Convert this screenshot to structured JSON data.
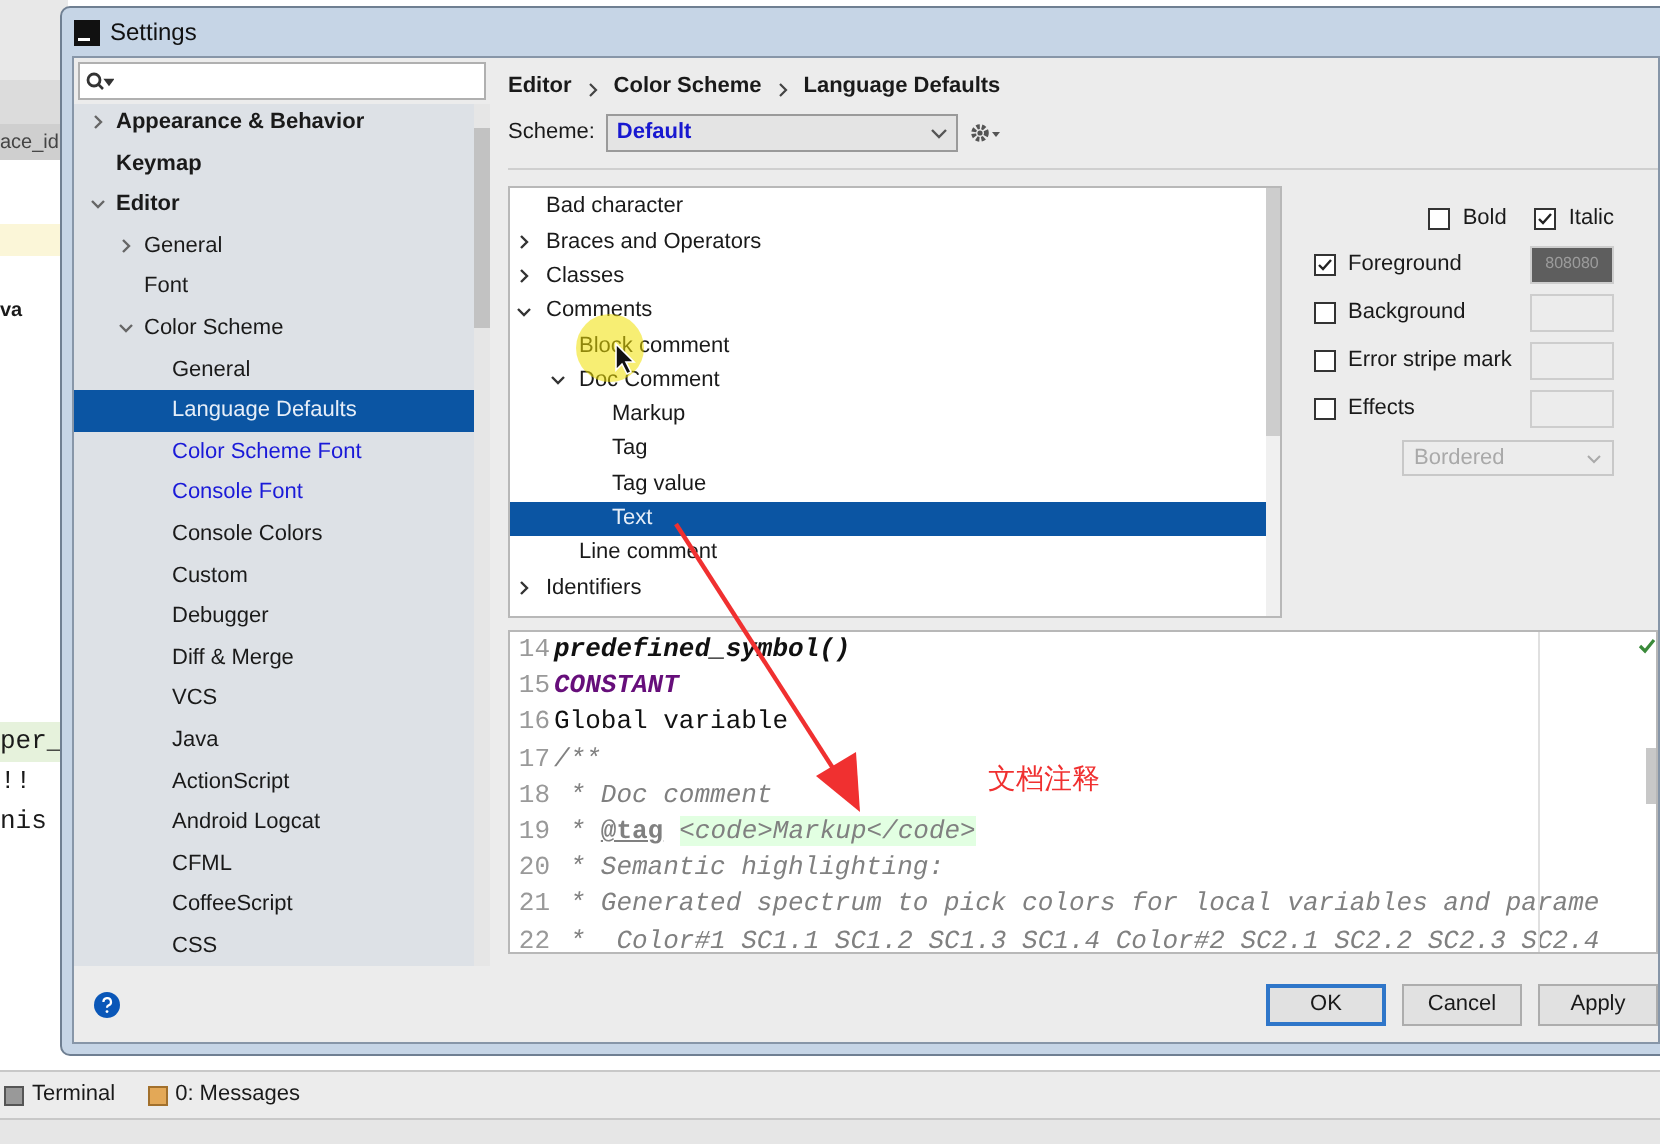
{
  "ide": {
    "tab": "ace_id",
    "fragments": [
      {
        "text": "va",
        "kind": "plain"
      },
      {
        "text": "per_",
        "kind": "highlight"
      },
      {
        "text": "!!",
        "kind": "plain"
      },
      {
        "text": "nis",
        "kind": "plain"
      }
    ],
    "tool_windows": [
      {
        "label": "Terminal",
        "kind": "terminal"
      },
      {
        "label": "0: Messages",
        "kind": "messages"
      }
    ]
  },
  "dialog": {
    "title": "Settings"
  },
  "sidebar": {
    "items": [
      {
        "label": "Appearance & Behavior",
        "expanded": false,
        "selected": false,
        "modified": false
      },
      {
        "label": "Keymap",
        "selected": false,
        "modified": false
      },
      {
        "label": "Editor",
        "expanded": true,
        "selected": false,
        "modified": false,
        "children": [
          {
            "label": "General",
            "expanded": false,
            "selected": false,
            "modified": false
          },
          {
            "label": "Font",
            "selected": false,
            "modified": false
          },
          {
            "label": "Color Scheme",
            "expanded": true,
            "selected": false,
            "modified": false,
            "children": [
              {
                "label": "General",
                "selected": false,
                "modified": false
              },
              {
                "label": "Language Defaults",
                "selected": true,
                "modified": false
              },
              {
                "label": "Color Scheme Font",
                "selected": false,
                "modified": true
              },
              {
                "label": "Console Font",
                "selected": false,
                "modified": true
              },
              {
                "label": "Console Colors",
                "selected": false,
                "modified": false
              },
              {
                "label": "Custom",
                "selected": false,
                "modified": false
              },
              {
                "label": "Debugger",
                "selected": false,
                "modified": false
              },
              {
                "label": "Diff & Merge",
                "selected": false,
                "modified": false
              },
              {
                "label": "VCS",
                "selected": false,
                "modified": false
              },
              {
                "label": "Java",
                "selected": false,
                "modified": false
              },
              {
                "label": "ActionScript",
                "selected": false,
                "modified": false
              },
              {
                "label": "Android Logcat",
                "selected": false,
                "modified": false
              },
              {
                "label": "CFML",
                "selected": false,
                "modified": false
              },
              {
                "label": "CoffeeScript",
                "selected": false,
                "modified": false
              },
              {
                "label": "CSS",
                "selected": false,
                "modified": false
              }
            ]
          }
        ]
      }
    ]
  },
  "breadcrumb": [
    "Editor",
    "Color Scheme",
    "Language Defaults"
  ],
  "scheme": {
    "label": "Scheme:",
    "value": "Default"
  },
  "attributes_tree": {
    "items": [
      {
        "label": "Bad character",
        "selected": false
      },
      {
        "label": "Braces and Operators",
        "expanded": false,
        "selected": false
      },
      {
        "label": "Classes",
        "expanded": false,
        "selected": false
      },
      {
        "label": "Comments",
        "expanded": true,
        "selected": false,
        "children": [
          {
            "label": "Block comment",
            "selected": false
          },
          {
            "label": "Doc Comment",
            "expanded": true,
            "selected": false,
            "children": [
              {
                "label": "Markup",
                "selected": false
              },
              {
                "label": "Tag",
                "selected": false
              },
              {
                "label": "Tag value",
                "selected": false
              },
              {
                "label": "Text",
                "selected": true
              }
            ]
          },
          {
            "label": "Line comment",
            "selected": false
          }
        ]
      },
      {
        "label": "Identifiers",
        "expanded": false,
        "selected": false
      }
    ]
  },
  "options": {
    "styles": [
      {
        "label": "Bold",
        "checked": false
      },
      {
        "label": "Italic",
        "checked": true
      }
    ],
    "colors": [
      {
        "label": "Foreground",
        "checked": true,
        "value": "808080"
      },
      {
        "label": "Background",
        "checked": false
      },
      {
        "label": "Error stripe mark",
        "checked": false
      },
      {
        "label": "Effects",
        "checked": false
      }
    ],
    "effect_type": {
      "value": "Bordered",
      "disabled": true
    }
  },
  "preview": {
    "lines": [
      {
        "number": "14",
        "segments": [
          {
            "text": "predefined_symbol()",
            "kind": "call"
          }
        ]
      },
      {
        "number": "15",
        "segments": [
          {
            "text": "CONSTANT",
            "kind": "constant"
          }
        ]
      },
      {
        "number": "16",
        "segments": [
          {
            "text": "Global variable",
            "kind": "plain"
          }
        ]
      },
      {
        "number": "17",
        "segments": [
          {
            "text": "/**",
            "kind": "comment"
          }
        ]
      },
      {
        "number": "18",
        "segments": [
          {
            "text": " * Doc comment",
            "kind": "comment"
          }
        ]
      },
      {
        "number": "19",
        "segments": [
          {
            "text": " * ",
            "kind": "comment"
          },
          {
            "text": "@tag",
            "kind": "doc_tag"
          },
          {
            "text": "<code>Markup</code>",
            "kind": "markup"
          }
        ]
      },
      {
        "number": "20",
        "segments": [
          {
            "text": " * Semantic highlighting:",
            "kind": "comment"
          }
        ]
      },
      {
        "number": "21",
        "segments": [
          {
            "text": " * Generated spectrum to pick colors for local variables and parame",
            "kind": "comment"
          }
        ]
      },
      {
        "number": "22",
        "segments": [
          {
            "text": " *  Color#1 SC1.1 SC1.2 SC1.3 SC1.4 Color#2 SC2.1 SC2.2 SC2.3 SC2.4",
            "kind": "comment"
          }
        ]
      }
    ]
  },
  "annotation": {
    "text": "文档注释"
  },
  "buttons": [
    {
      "label": "OK",
      "default": true
    },
    {
      "label": "Cancel",
      "default": false
    },
    {
      "label": "Apply",
      "default": false
    }
  ]
}
